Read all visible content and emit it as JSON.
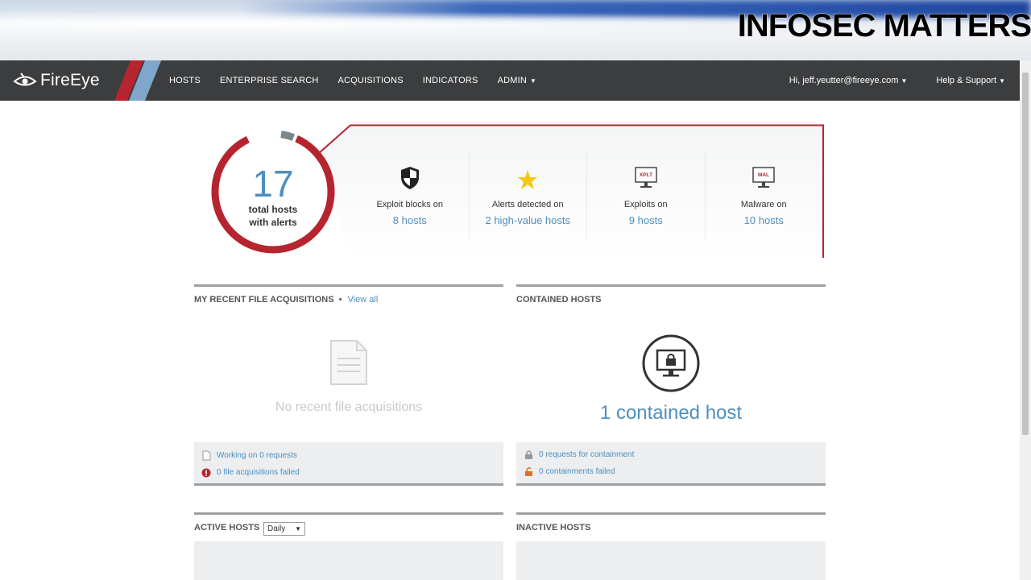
{
  "watermark": "INFOSEC MATTERS",
  "nav": {
    "brand": "FireEye",
    "links": [
      "HOSTS",
      "ENTERPRISE SEARCH",
      "ACQUISITIONS",
      "INDICATORS",
      "ADMIN"
    ],
    "user": "Hi, jeff.yeutter@fireeye.com",
    "help": "Help & Support"
  },
  "alerts": {
    "total": "17",
    "total_label_1": "total hosts",
    "total_label_2": "with alerts",
    "stats": [
      {
        "label": "Exploit blocks on",
        "link": "8 hosts",
        "icon": "shield-icon"
      },
      {
        "label": "Alerts detected on",
        "link": "2 high-value hosts",
        "icon": "star-icon"
      },
      {
        "label": "Exploits on",
        "link": "9 hosts",
        "icon": "exploit-monitor-icon",
        "badge": "XPLT"
      },
      {
        "label": "Malware on",
        "link": "10 hosts",
        "icon": "malware-monitor-icon",
        "badge": "MAL"
      }
    ]
  },
  "acquisitions": {
    "title": "MY RECENT FILE ACQUISITIONS",
    "separator": "•",
    "view_all": "View all",
    "empty": "No recent file acquisitions",
    "working": "Working on 0 requests",
    "failed": "0 file acquisitions failed"
  },
  "contained": {
    "title": "CONTAINED HOSTS",
    "count_text": "1 contained host",
    "requests": "0 requests for containment",
    "failed": "0 containments failed"
  },
  "active": {
    "title": "ACTIVE HOSTS",
    "period": "Daily"
  },
  "inactive": {
    "title": "INACTIVE HOSTS"
  },
  "colors": {
    "nav_bg": "#3b3d3f",
    "accent_red": "#b6242f",
    "accent_blue": "#4f8fbf",
    "star": "#f2c811"
  }
}
